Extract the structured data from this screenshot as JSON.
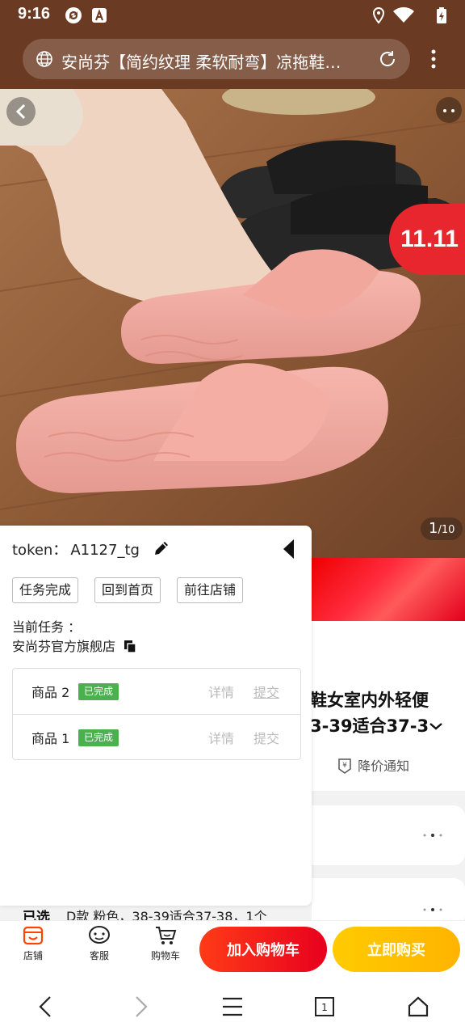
{
  "status_bar": {
    "time": "9:16",
    "icons": [
      "sync-app-icon",
      "a-app-icon",
      "location-icon",
      "wifi-icon",
      "battery-charging-icon"
    ]
  },
  "browser": {
    "url_title": "安尚芬【简约纹理 柔软耐弯】凉拖鞋…",
    "icons": [
      "globe-icon",
      "reload-icon",
      "more-vert-icon"
    ]
  },
  "hero": {
    "image_counter_current": "1",
    "image_counter_total": "/10",
    "badge_text": "11.11",
    "icons": [
      "back-arrow-icon",
      "more-dots-icon"
    ]
  },
  "panel": {
    "token_label": "token：",
    "token_value": "A1127_tg",
    "buttons": {
      "task_done": "任务完成",
      "home": "回到首页",
      "store": "前往店铺"
    },
    "current_task_label": "当前任务 ：",
    "current_task_store": "安尚芬官方旗舰店",
    "tasks": [
      {
        "name": "商品 2",
        "status": "已完成",
        "detail": "详情",
        "submit": "提交"
      },
      {
        "name": "商品 1",
        "status": "已完成",
        "detail": "详情",
        "submit": "提交"
      }
    ]
  },
  "product": {
    "title_line1": "鞋女室内外轻便",
    "title_line2": "3-39适合37-3",
    "price_notify": "降价通知"
  },
  "selection": {
    "label": "已选",
    "value": "D款 粉色，38-39适合37-38，1个"
  },
  "toolbar": {
    "store": "店铺",
    "service": "客服",
    "cart": "购物车",
    "add_to_cart": "加入购物车",
    "buy_now": "立即购买"
  },
  "colors": {
    "browser_bar": "#6b3a22",
    "cart_button": "#e8001e",
    "buy_button": "#ffb400",
    "done_badge": "#4caf50"
  }
}
